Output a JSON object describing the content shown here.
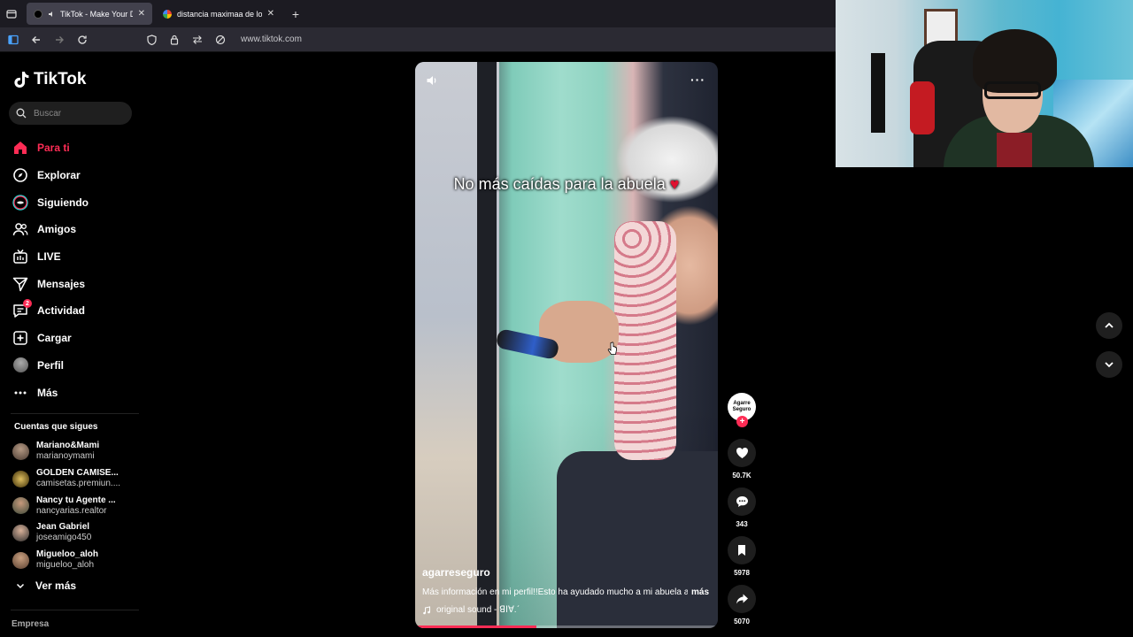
{
  "browser": {
    "tabs": [
      {
        "title": "TikTok - Make Your Day",
        "active": true
      },
      {
        "title": "distancia maximaa de los misile",
        "active": false
      }
    ],
    "url": "www.tiktok.com"
  },
  "sidebar": {
    "logo": "TikTok",
    "search_placeholder": "Buscar",
    "menu": [
      {
        "label": "Para ti",
        "icon": "home-icon",
        "active": true
      },
      {
        "label": "Explorar",
        "icon": "compass-icon"
      },
      {
        "label": "Siguiendo",
        "icon": "following-icon"
      },
      {
        "label": "Amigos",
        "icon": "friends-icon"
      },
      {
        "label": "LIVE",
        "icon": "live-icon"
      },
      {
        "label": "Mensajes",
        "icon": "messages-icon"
      },
      {
        "label": "Actividad",
        "icon": "activity-icon",
        "badge": "2"
      },
      {
        "label": "Cargar",
        "icon": "upload-icon"
      },
      {
        "label": "Perfil",
        "icon": "avatar"
      },
      {
        "label": "Más",
        "icon": "more-icon"
      }
    ],
    "following_title": "Cuentas que sigues",
    "following": [
      {
        "name": "Mariano&Mami",
        "handle": "marianoymami"
      },
      {
        "name": "GOLDEN CAMISE...",
        "handle": "camisetas.premiun...."
      },
      {
        "name": "Nancy tu Agente ...",
        "handle": "nancyarias.realtor"
      },
      {
        "name": "Jean Gabriel",
        "handle": "joseamigo450"
      },
      {
        "name": "Migueloo_aloh",
        "handle": "migueloo_aloh"
      }
    ],
    "see_more": "Ver más",
    "footer": "Empresa"
  },
  "video": {
    "caption": "No más caídas para la abuela",
    "caption_emoji": "♥",
    "username": "agarreseguro",
    "description": "Más información en mi perfil!!Esto ha ayudado mucho a mi abuela a",
    "more_label": "más",
    "sound": "original sound - ꓭꓲꓯ.ˊ",
    "progress": 0.4
  },
  "actions": {
    "creator_label": "Agarre Seguro",
    "likes": "50.7K",
    "comments": "343",
    "saves": "5978",
    "shares": "5070"
  },
  "colors": {
    "accent": "#fe2c55",
    "background": "#000000"
  }
}
